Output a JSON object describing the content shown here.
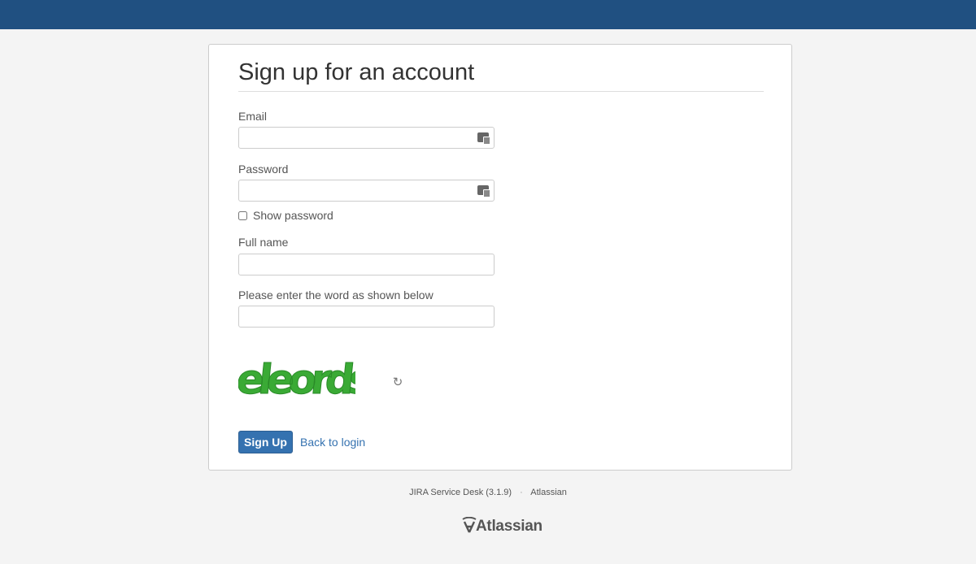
{
  "header": {
    "color": "#205081"
  },
  "form": {
    "title": "Sign up for an account",
    "email_label": "Email",
    "email_value": "",
    "email_icon": "password-manager-icon",
    "password_label": "Password",
    "password_value": "",
    "password_icon": "password-manager-icon",
    "show_password_label": "Show password",
    "show_password_checked": false,
    "fullname_label": "Full name",
    "fullname_value": "",
    "captcha_label": "Please enter the word as shown below",
    "captcha_value": "",
    "captcha_text": "eleords",
    "refresh_icon": "refresh-icon",
    "signup_label": "Sign Up",
    "back_label": "Back to login",
    "accent_color": "#3572b0"
  },
  "footer": {
    "product": "JIRA Service Desk (3.1.9)",
    "separator": "·",
    "company": "Atlassian",
    "logo_text": "Atlassian"
  }
}
